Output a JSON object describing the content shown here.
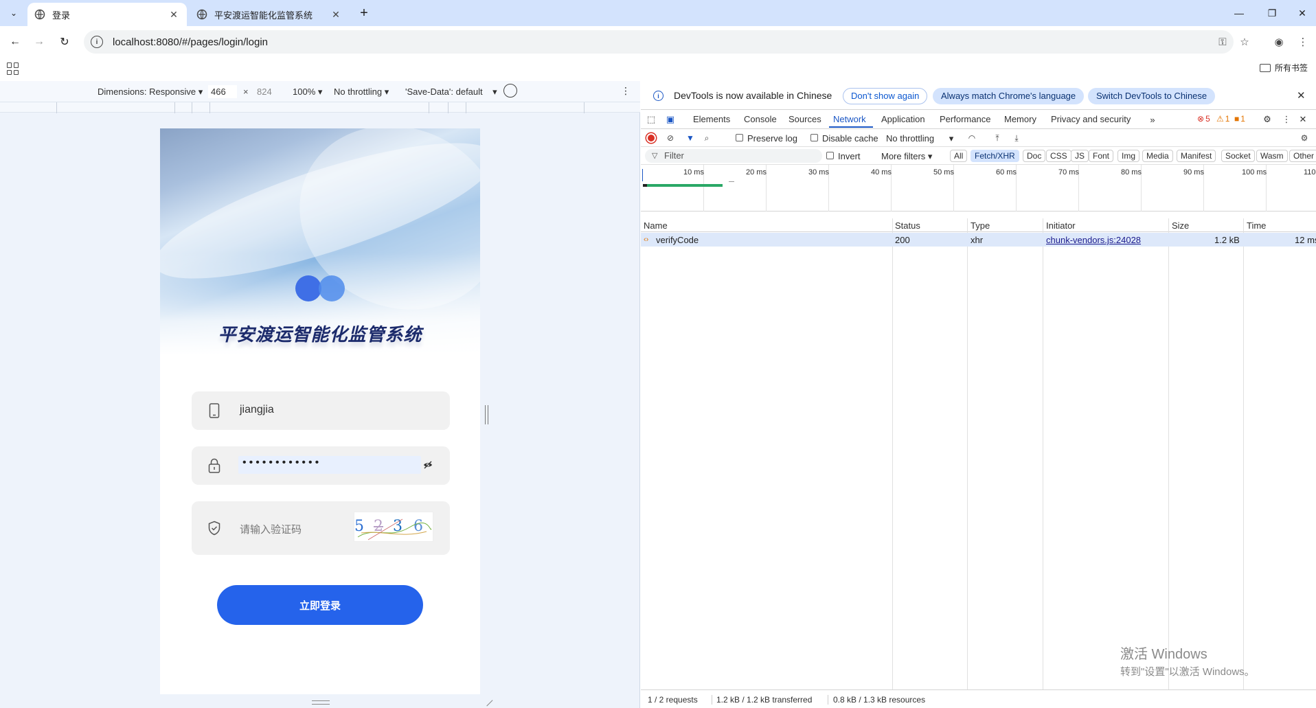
{
  "browser": {
    "tabs": [
      {
        "title": "登录",
        "active": true
      },
      {
        "title": "平安渡运智能化监管系统",
        "active": false
      }
    ],
    "url": "localhost:8080/#/pages/login/login",
    "bookmarks_label": "所有书签"
  },
  "device_toolbar": {
    "dimensions_label": "Dimensions: Responsive",
    "width": "466",
    "height": "824",
    "zoom": "100%",
    "throttling": "No throttling",
    "save_data": "'Save-Data': default"
  },
  "app": {
    "title": "平安渡运智能化监管系统",
    "username_value": "jiangjia",
    "password_dots": "••••••••••••",
    "captcha_placeholder": "请输入验证码",
    "captcha_chars": [
      "5",
      "2",
      "3",
      "6"
    ],
    "login_button": "立即登录"
  },
  "devtools": {
    "infobar": {
      "message": "DevTools is now available in Chinese",
      "dont_show": "Don't show again",
      "always_match": "Always match Chrome's language",
      "switch": "Switch DevTools to Chinese"
    },
    "panels": [
      "Elements",
      "Console",
      "Sources",
      "Network",
      "Application",
      "Performance",
      "Memory",
      "Privacy and security"
    ],
    "active_panel": "Network",
    "errors": "5",
    "warnings": "1",
    "issues": "1",
    "network_toolbar": {
      "preserve_log": "Preserve log",
      "disable_cache": "Disable cache",
      "throttling": "No throttling"
    },
    "filter": {
      "placeholder": "Filter",
      "invert": "Invert",
      "more_filters": "More filters",
      "types": [
        "All",
        "Fetch/XHR",
        "Doc",
        "CSS",
        "JS",
        "Font",
        "Img",
        "Media",
        "Manifest",
        "Socket",
        "Wasm",
        "Other"
      ],
      "selected_type": "Fetch/XHR"
    },
    "timeline_ticks": [
      "10 ms",
      "20 ms",
      "30 ms",
      "40 ms",
      "50 ms",
      "60 ms",
      "70 ms",
      "80 ms",
      "90 ms",
      "100 ms",
      "110"
    ],
    "columns": [
      "Name",
      "Status",
      "Type",
      "Initiator",
      "Size",
      "Time"
    ],
    "rows": [
      {
        "name": "verifyCode",
        "status": "200",
        "type": "xhr",
        "initiator": "chunk-vendors.js:24028",
        "size": "1.2 kB",
        "time": "12 ms"
      }
    ],
    "status": {
      "requests": "1 / 2 requests",
      "transferred": "1.2 kB / 1.2 kB transferred",
      "resources": "0.8 kB / 1.3 kB resources"
    },
    "colors": {
      "accent": "#1a56c4",
      "selected_row": "#dde8fa"
    }
  },
  "watermark": {
    "line1": "激活 Windows",
    "line2": "转到\"设置\"以激活 Windows。"
  }
}
